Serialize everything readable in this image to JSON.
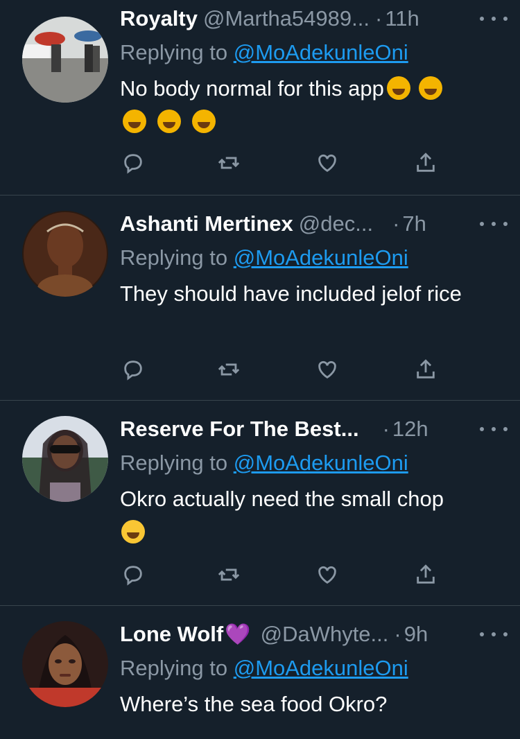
{
  "tweets": [
    {
      "name": "Royalty",
      "name_emoji": "",
      "handle": "@Martha54989...",
      "dot": "·",
      "time": "11h",
      "replying_prefix": "Replying to",
      "replying_to": "@MoAdekunleOni",
      "text": "No body normal for this app",
      "emojis": [
        "rofl-emoji",
        "rofl-emoji",
        "rofl-emoji",
        "rofl-emoji",
        "rofl-emoji"
      ],
      "avatar_colors": [
        "#d7dad9",
        "#6d6a62",
        "#b5322e"
      ]
    },
    {
      "name": "Ashanti Mertinex",
      "name_emoji": "",
      "handle": "@dec...",
      "dot": "·",
      "time": "7h",
      "replying_prefix": "Replying to",
      "replying_to": "@MoAdekunleOni",
      "text": "They should have included jelof rice",
      "emojis": [],
      "avatar_colors": [
        "#2a1a12",
        "#6a3a22",
        "#c07a4a"
      ]
    },
    {
      "name": "Reserve For The Best...",
      "name_emoji": "",
      "handle": "",
      "dot": "·",
      "time": "12h",
      "replying_prefix": "Replying to",
      "replying_to": "@MoAdekunleOni",
      "text": "Okro actually need the small chop",
      "emojis": [
        "loudly-crying-emoji"
      ],
      "avatar_colors": [
        "#d8dee6",
        "#3f5a46",
        "#2b2226"
      ]
    },
    {
      "name": "Lone Wolf",
      "name_emoji": "💜",
      "handle": "@DaWhyte...",
      "dot": "·",
      "time": "9h",
      "replying_prefix": "Replying to",
      "replying_to": "@MoAdekunleOni",
      "text": "Where’s the sea food Okro?",
      "emojis": [],
      "avatar_colors": [
        "#2a1a18",
        "#c0392b",
        "#8c5a3c"
      ]
    }
  ],
  "icons": [
    "reply-icon",
    "retweet-icon",
    "like-icon",
    "share-icon",
    "more-icon"
  ],
  "colors": {
    "background": "#15202b",
    "link": "#1d9bf0",
    "muted": "#8b98a5",
    "divider": "#38444d"
  }
}
